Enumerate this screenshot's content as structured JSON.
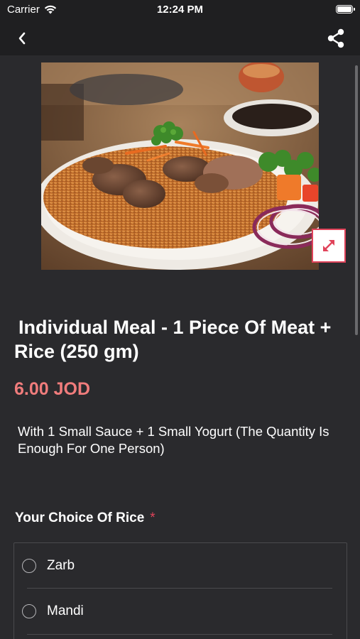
{
  "status_bar": {
    "carrier": "Carrier",
    "time": "12:24 PM"
  },
  "nav": {
    "back_icon": "chevron-left-icon",
    "share_icon": "share-icon"
  },
  "product": {
    "title": "Individual Meal - 1 Piece Of Meat + Rice (250 gm)",
    "price": "6.00 JOD",
    "description": "With 1 Small Sauce + 1 Small Yogurt (The Quantity Is Enough For One Person)",
    "expand_icon": "expand-icon"
  },
  "choice_section": {
    "title": "Your Choice Of Rice",
    "required_mark": "*",
    "options": [
      {
        "label": "Zarb"
      },
      {
        "label": "Mandi"
      }
    ]
  },
  "colors": {
    "background": "#2a2a2d",
    "bar": "#1f1f21",
    "price": "#f07c7c",
    "accent": "#e0435a"
  }
}
